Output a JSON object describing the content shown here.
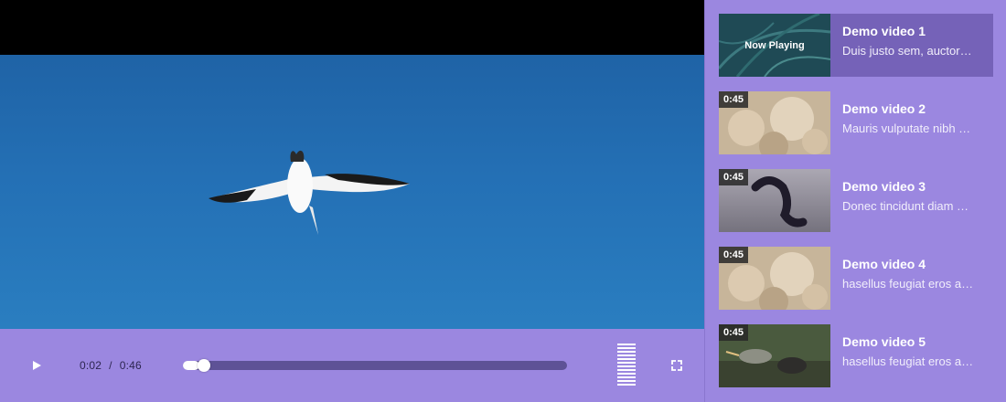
{
  "player": {
    "current_time": "0:02",
    "time_separator": "/",
    "duration": "0:46",
    "progress_fraction": 0.043,
    "icons": {
      "play": "play-icon",
      "volume": "volume-bars",
      "fullscreen": "fullscreen-icon"
    }
  },
  "playlist": {
    "now_playing_label": "Now Playing",
    "items": [
      {
        "title": "Demo video 1",
        "description": "Duis justo sem, auctor…",
        "duration": "",
        "active": true
      },
      {
        "title": "Demo video 2",
        "description": "Mauris vulputate nibh …",
        "duration": "0:45",
        "active": false
      },
      {
        "title": "Demo video 3",
        "description": "Donec tincidunt diam …",
        "duration": "0:45",
        "active": false
      },
      {
        "title": "Demo video 4",
        "description": "hasellus feugiat eros a…",
        "duration": "0:45",
        "active": false
      },
      {
        "title": "Demo video 5",
        "description": "hasellus feugiat eros a…",
        "duration": "0:45",
        "active": false
      }
    ]
  },
  "colors": {
    "accent": "#9b87e0",
    "active_item": "#7562b8",
    "track": "#5e5296"
  }
}
